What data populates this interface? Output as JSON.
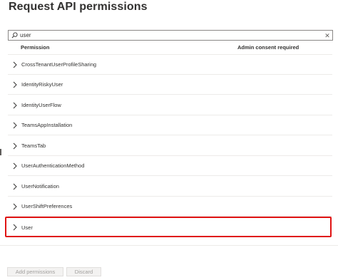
{
  "panel": {
    "title": "Request API permissions"
  },
  "search": {
    "value": "user",
    "icon": "search-icon",
    "clear_glyph": "✕"
  },
  "table": {
    "columns": [
      "Permission",
      "Admin consent required"
    ],
    "rows": [
      {
        "label": "CrossTenantUserProfileSharing"
      },
      {
        "label": "IdentityRiskyUser"
      },
      {
        "label": "IdentityUserFlow"
      },
      {
        "label": "TeamsAppInstallation"
      },
      {
        "label": "TeamsTab"
      },
      {
        "label": "UserAuthenticationMethod"
      },
      {
        "label": "UserNotification"
      },
      {
        "label": "UserShiftPreferences"
      },
      {
        "label": "User"
      }
    ],
    "highlighted_row": "User"
  },
  "footer": {
    "add_label": "Add permissions",
    "discard_label": "Discard"
  },
  "colors": {
    "highlight": "#e01313",
    "text": "#323130",
    "disabled_text": "#a19f9d"
  }
}
